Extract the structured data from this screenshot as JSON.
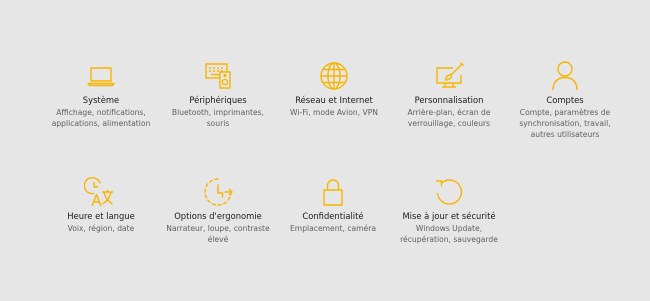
{
  "colors": {
    "background": "#e6e6e6",
    "accent": "#f7b500",
    "title": "#1a1a1a",
    "description": "#5f5f5f"
  },
  "tiles": [
    {
      "icon": "laptop-icon",
      "title": "Système",
      "desc": "Affichage, notifications, applications, alimentation"
    },
    {
      "icon": "devices-icon",
      "title": "Périphériques",
      "desc": "Bluetooth, imprimantes, souris"
    },
    {
      "icon": "globe-icon",
      "title": "Réseau et Internet",
      "desc": "Wi-Fi, mode Avion, VPN"
    },
    {
      "icon": "paint-icon",
      "title": "Personnalisation",
      "desc": "Arrière-plan, écran de verrouillage, couleurs"
    },
    {
      "icon": "person-icon",
      "title": "Comptes",
      "desc": "Compte, paramètres de synchronisation, travail, autres utilisateurs"
    },
    {
      "icon": "time-language-icon",
      "title": "Heure et langue",
      "desc": "Voix, région, date"
    },
    {
      "icon": "ease-of-access-icon",
      "title": "Options d'ergonomie",
      "desc": "Narrateur, loupe, contraste élevé"
    },
    {
      "icon": "lock-icon",
      "title": "Confidentialité",
      "desc": "Emplacement, caméra"
    },
    {
      "icon": "update-icon",
      "title": "Mise à jour et sécurité",
      "desc": "Windows Update, récupération, sauvegarde"
    }
  ]
}
